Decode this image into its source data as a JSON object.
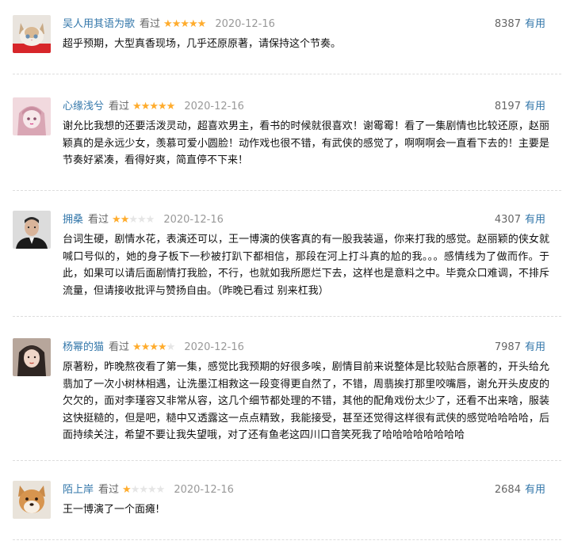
{
  "reviews": [
    {
      "user": "吴人用其语为歌",
      "status": "看过",
      "rating": 5,
      "date": "2020-12-16",
      "votes": "8387",
      "useful": "有用",
      "avatar_icon": "cat-avatar",
      "content": "超乎预期，大型真香现场，几乎还原原著，请保持这个节奏。"
    },
    {
      "user": "心缘浅兮",
      "status": "看过",
      "rating": 5,
      "date": "2020-12-16",
      "votes": "8197",
      "useful": "有用",
      "avatar_icon": "anime-girl-avatar",
      "content": "谢允比我想的还要活泼灵动，超喜欢男主，看书的时候就很喜欢！谢霉霉！看了一集剧情也比较还原，赵丽颖真的是永远少女，羡慕可爱小圆脸！动作戏也很不错，有武侠的感觉了，啊啊啊会一直看下去的！主要是节奏好紧凑，看得好爽，简直停不下来！"
    },
    {
      "user": "拥桑",
      "status": "看过",
      "rating": 2,
      "date": "2020-12-16",
      "votes": "4307",
      "useful": "有用",
      "avatar_icon": "man-portrait-avatar",
      "content": "台词生硬，剧情水花，表演还可以，王一博演的侠客真的有一股我装逼，你来打我的感觉。赵丽颖的侠女就喊口号似的，她的身子板下一秒被打趴下都相信，那段在河上打斗真的尬的我。。。感情线为了做而作。于此，如果可以请后面剧情打我脸，不行，也就如我所愿烂下去，这样也是意料之中。毕竟众口难调，不排斥流量，但请接收批评与赞扬自由。（昨晚已看过 别来杠我）"
    },
    {
      "user": "杨幂的猫",
      "status": "看过",
      "rating": 4,
      "date": "2020-12-16",
      "votes": "7987",
      "useful": "有用",
      "avatar_icon": "woman-portrait-avatar",
      "content": "原著粉，昨晚熬夜看了第一集，感觉比我预期的好很多唉，剧情目前来说整体是比较贴合原著的，开头给允翡加了一次小树林相遇，让洗墨江相救这一段变得更自然了，不错，周翡挨打那里咬嘴唇，谢允开头皮皮的欠欠的，面对李瑾容又非常从容，这几个细节都处理的不错，其他的配角戏份太少了，还看不出来啥，服装这快挺糙的，但是吧，糙中又透露这一点点精致，我能接受，甚至还觉得这样很有武侠的感觉哈哈哈哈，后面持续关注，希望不要让我失望哦，对了还有鱼老这四川口音笑死我了哈哈哈哈哈哈哈哈"
    },
    {
      "user": "陌上岸",
      "status": "看过",
      "rating": 1,
      "date": "2020-12-16",
      "votes": "2684",
      "useful": "有用",
      "avatar_icon": "shiba-dog-avatar",
      "content": "王一博演了一个面瘫!"
    }
  ],
  "colors": {
    "link": "#3377aa",
    "star_on": "#ffac2d",
    "star_off": "#e5e5e5",
    "date": "#999999"
  }
}
